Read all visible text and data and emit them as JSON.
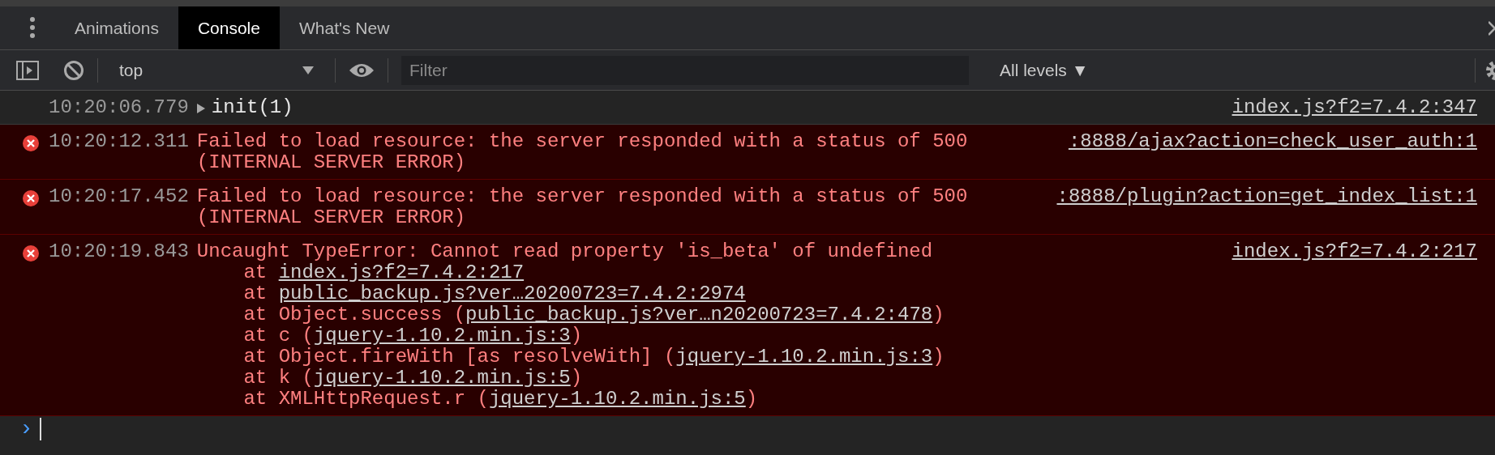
{
  "tabs": [
    {
      "label": "Animations",
      "selected": false
    },
    {
      "label": "Console",
      "selected": true
    },
    {
      "label": "What's New",
      "selected": false
    }
  ],
  "toolbar": {
    "context": "top",
    "filter_placeholder": "Filter",
    "levels": "All levels ▼"
  },
  "messages": [
    {
      "kind": "log",
      "time": "10:20:06.779",
      "expandable": true,
      "text": "init(1)",
      "source": "index.js?f2=7.4.2:347"
    },
    {
      "kind": "error",
      "time": "10:20:12.311",
      "text": "Failed to load resource: the server responded with a status of 500 (INTERNAL SERVER ERROR)",
      "source": ":8888/ajax?action=check_user_auth:1"
    },
    {
      "kind": "error",
      "time": "10:20:17.452",
      "text": "Failed to load resource: the server responded with a status of 500 (INTERNAL SERVER ERROR)",
      "source": ":8888/plugin?action=get_index_list:1"
    },
    {
      "kind": "error",
      "time": "10:20:19.843",
      "text": "Uncaught TypeError: Cannot read property 'is_beta' of undefined",
      "source": "index.js?f2=7.4.2:217",
      "frames": [
        {
          "before": "at ",
          "link": "index.js?f2=7.4.2:217"
        },
        {
          "before": "at ",
          "link": "public_backup.js?ver…20200723=7.4.2:2974"
        },
        {
          "before": "at Object.success (",
          "link": "public_backup.js?ver…n20200723=7.4.2:478",
          "after": ")"
        },
        {
          "before": "at c (",
          "link": "jquery-1.10.2.min.js:3",
          "after": ")"
        },
        {
          "before": "at Object.fireWith [as resolveWith] (",
          "link": "jquery-1.10.2.min.js:3",
          "after": ")"
        },
        {
          "before": "at k (",
          "link": "jquery-1.10.2.min.js:5",
          "after": ")"
        },
        {
          "before": "at XMLHttpRequest.r (",
          "link": "jquery-1.10.2.min.js:5",
          "after": ")"
        }
      ]
    }
  ],
  "prompt": {
    "symbol": "›"
  }
}
